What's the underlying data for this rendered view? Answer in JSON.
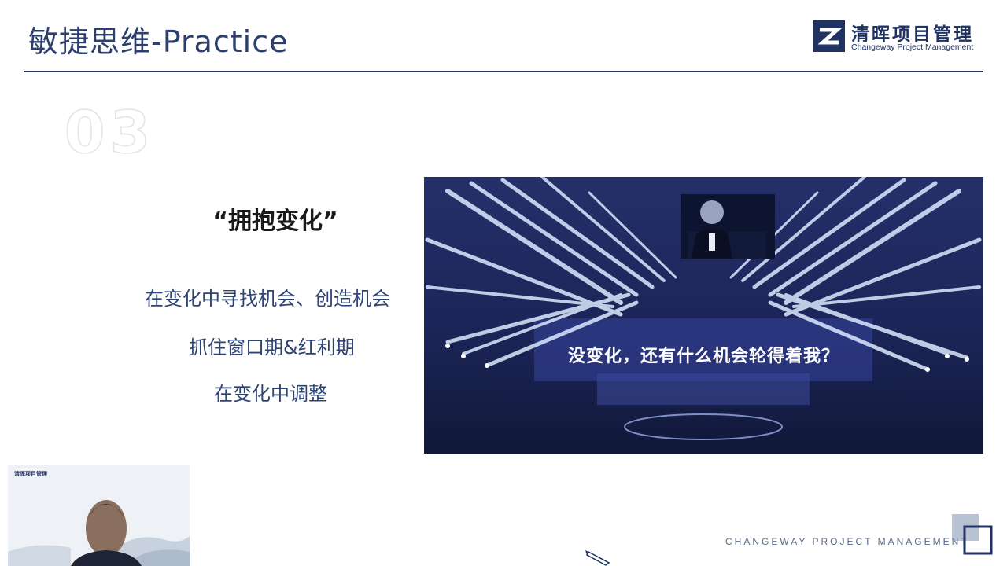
{
  "header": {
    "title": "敏捷思维-Practice",
    "logo_cn": "清晖项目管理",
    "logo_en": "Changeway Project Management"
  },
  "section": {
    "number": "03",
    "heading": "“拥抱变化”",
    "bullets": [
      "在变化中寻找机会、创造机会",
      "抓住窗口期&红利期",
      "在变化中调整"
    ]
  },
  "photo": {
    "subtitle": "没变化，还有什么机会轮得着我？"
  },
  "webcam": {
    "logo_text": "清晖项目管理"
  },
  "footer": {
    "text": "CHANGEWAY PROJECT MANAGEMENT"
  },
  "colors": {
    "primary": "#1f3262",
    "bullet_text": "#2e4375",
    "stage_blue": "#1b2456"
  },
  "icons": [
    "changeway-logo-icon",
    "corner-squares-icon",
    "pen-cursor-icon"
  ]
}
